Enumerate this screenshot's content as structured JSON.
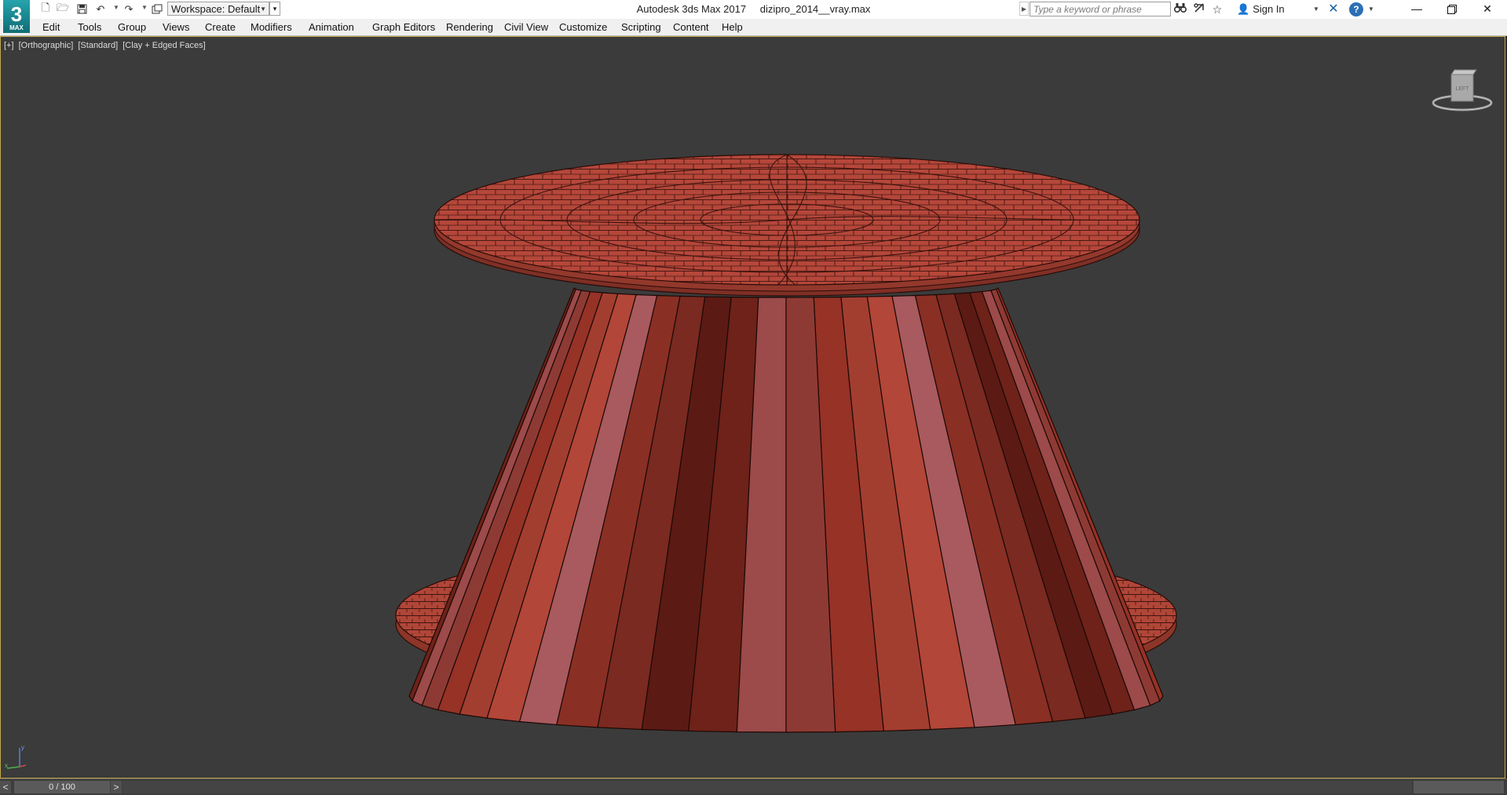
{
  "app": {
    "title": "Autodesk 3ds Max 2017",
    "file_name": "dizipro_2014__vray.max",
    "logo_text": "3",
    "logo_sub": "MAX"
  },
  "toolbar": {
    "workspace_label": "Workspace: Default",
    "search_placeholder": "Type a keyword or phrase",
    "sign_in_label": "Sign In"
  },
  "menu": {
    "items": [
      "Edit",
      "Tools",
      "Group",
      "Views",
      "Create",
      "Modifiers",
      "Animation",
      "Graph Editors",
      "Rendering",
      "Civil View",
      "Customize",
      "Scripting",
      "Content",
      "Help"
    ]
  },
  "viewport": {
    "label_plus": "[+]",
    "label_view": "[Orthographic]",
    "label_shading": "[Standard]",
    "label_mode": "[Clay + Edged Faces]",
    "viewcube_face": "LEFT",
    "axis_y": "y",
    "axis_x": "x"
  },
  "timeline": {
    "prev": "<",
    "frame_display": "0 / 100",
    "next": ">"
  },
  "colors": {
    "viewport_bg": "#3b3b3b",
    "viewport_border": "#c2a84b",
    "model_clay": "#b4473a"
  }
}
